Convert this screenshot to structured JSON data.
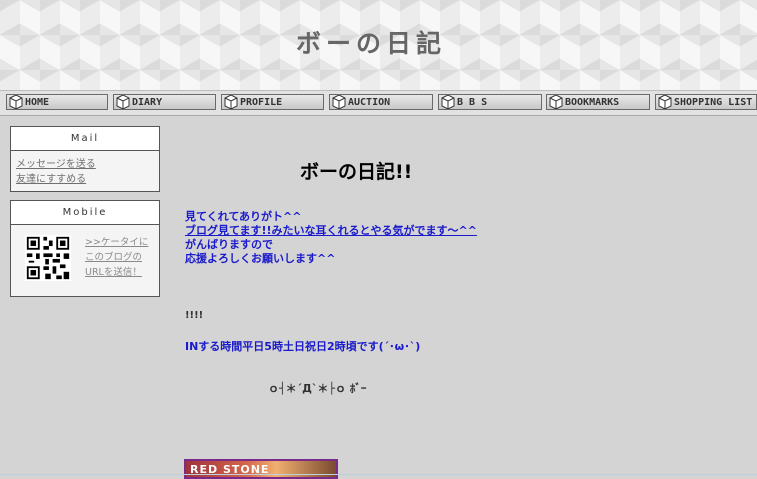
{
  "header": {
    "title": "ボーの日記"
  },
  "nav": {
    "items": [
      {
        "label": "HOME"
      },
      {
        "label": "DIARY"
      },
      {
        "label": "PROFILE"
      },
      {
        "label": "AUCTION"
      },
      {
        "label": "B B S"
      },
      {
        "label": "BOOKMARKS"
      },
      {
        "label": "SHOPPING LIST"
      }
    ]
  },
  "sidebar": {
    "mail": {
      "heading": "Mail",
      "links": [
        "メッセージを送る",
        "友達にすすめる"
      ]
    },
    "mobile": {
      "heading": "Mobile",
      "link_lines": [
        ">>ケータイに",
        "このブログの",
        "URLを送信！"
      ]
    }
  },
  "main": {
    "title": "ボーの日記!!",
    "intro": {
      "line1": "見てくれてありがト^^",
      "line2": "ブログ見てます!!みたいな耳くれるとやる気がでます～^^",
      "line3": "がんばりますので",
      "line4": "応援よろしくお願いします^^"
    },
    "exclaim": "!!!!",
    "schedule": "INする時間平日5時土日祝日2時頃です(´･ω･`)",
    "kaomoji": "ｏ┤＊´Д`＊├ｏ ﾎﾞｰ",
    "banner_text": "RED STONE"
  },
  "colors": {
    "link_blue": "#1a1acc",
    "background": "#d4d4d4",
    "banner_border": "#7a2a88"
  }
}
